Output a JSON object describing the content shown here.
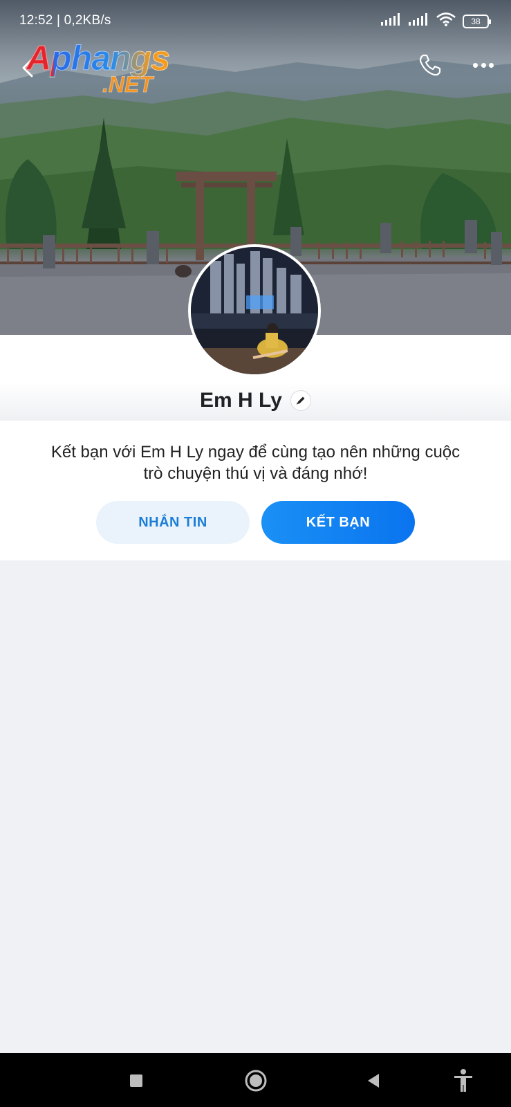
{
  "status_bar": {
    "time": "12:52 | 0,2KB/s",
    "battery": "38",
    "icons": [
      "signal-icon",
      "signal-icon",
      "wifi-icon",
      "battery-icon"
    ]
  },
  "header": {
    "logo_main": "Aphangs",
    "logo_sub": ".NET",
    "icons": [
      "back-icon",
      "phone-icon",
      "more-icon"
    ]
  },
  "profile": {
    "name": "Em H Ly"
  },
  "invite": {
    "text": "Kết bạn với Em H Ly ngay để cùng tạo nên những cuộc trò chuyện thú vị và đáng nhớ!",
    "message_label": "NHẮN TIN",
    "add_friend_label": "KẾT BẠN"
  },
  "colors": {
    "accent": "#0a74ef",
    "message_bg": "#eaf3fb",
    "message_text": "#1b7dd6",
    "page_bg": "#eff1f5"
  },
  "nav": {
    "icons": [
      "recent-apps-icon",
      "home-icon",
      "back-icon",
      "accessibility-icon"
    ]
  }
}
